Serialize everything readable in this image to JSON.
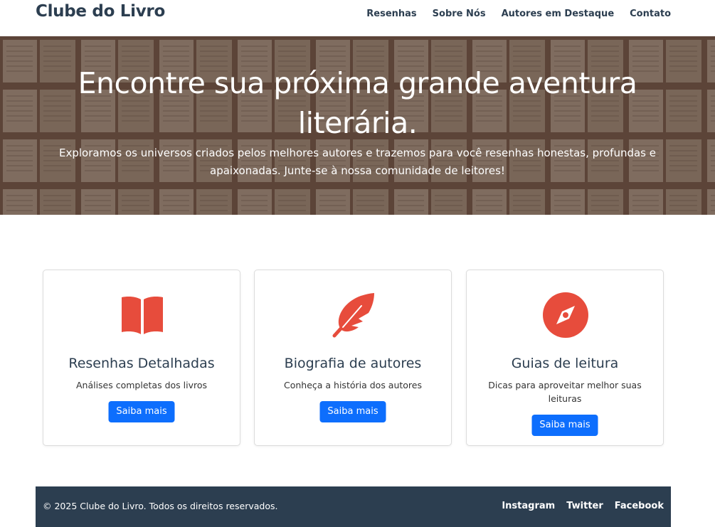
{
  "nav": {
    "brand": "Clube do Livro",
    "links": [
      "Resenhas",
      "Sobre Nós",
      "Autores em Destaque",
      "Contato"
    ]
  },
  "hero": {
    "title": "Encontre sua próxima grande aventura literária.",
    "text": "Exploramos os universos criados pelos melhores autores e trazemos para você resenhas honestas, profundas e apaixonadas. Junte-se à nossa comunidade de leitores!"
  },
  "cards": [
    {
      "icon": "book-open-icon",
      "title": "Resenhas Detalhadas",
      "text": "Análises completas dos livros",
      "button": "Saiba mais"
    },
    {
      "icon": "feather-icon",
      "title": "Biografia de autores",
      "text": "Conheça a história dos autores",
      "button": "Saiba mais"
    },
    {
      "icon": "compass-icon",
      "title": "Guias de leitura",
      "text": "Dicas para aproveitar melhor suas leituras",
      "button": "Saiba mais"
    }
  ],
  "footer": {
    "copyright": "© 2025 Clube do Livro. Todos os direitos reservados.",
    "links": [
      "Instagram",
      "Twitter",
      "Facebook"
    ]
  },
  "colors": {
    "primary": "#0d6efd",
    "dark": "#2c3e50",
    "icon": "#e74c3c"
  }
}
